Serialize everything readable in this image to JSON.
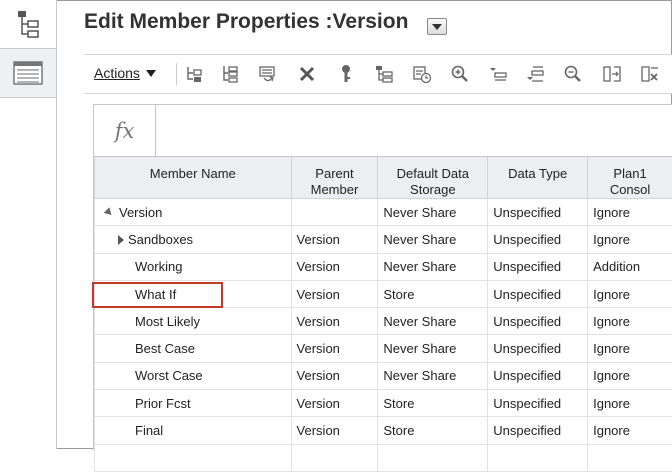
{
  "header": {
    "title": "Edit Member Properties :Version"
  },
  "toolbar": {
    "actions_label": "Actions",
    "icons": [
      "add-sibling-icon",
      "add-child-icon",
      "edit-member-icon",
      "delete-icon",
      "key-icon",
      "tree-view-icon",
      "history-icon",
      "zoom-in-icon",
      "move-up-icon",
      "move-down-icon",
      "zoom-out-icon",
      "expand-column-icon",
      "clear-filter-icon"
    ]
  },
  "formula_bar": {
    "label": "fx"
  },
  "grid": {
    "columns": [
      "Member Name",
      "Parent\nMember",
      "Default Data\nStorage",
      "Data Type",
      "Plan1\nConsol"
    ],
    "rows": [
      {
        "name": "Version",
        "parent": "",
        "storage": "Never Share",
        "type": "Unspecified",
        "consol": "Ignore",
        "level": 0,
        "toggle": "expanded"
      },
      {
        "name": "Sandboxes",
        "parent": "Version",
        "storage": "Never Share",
        "type": "Unspecified",
        "consol": "Ignore",
        "level": 1,
        "toggle": "collapsed"
      },
      {
        "name": "Working",
        "parent": "Version",
        "storage": "Never Share",
        "type": "Unspecified",
        "consol": "Addition",
        "level": 1,
        "toggle": ""
      },
      {
        "name": "What If",
        "parent": "Version",
        "storage": "Store",
        "type": "Unspecified",
        "consol": "Ignore",
        "level": 1,
        "toggle": ""
      },
      {
        "name": "Most Likely",
        "parent": "Version",
        "storage": "Never Share",
        "type": "Unspecified",
        "consol": "Ignore",
        "level": 1,
        "toggle": ""
      },
      {
        "name": "Best Case",
        "parent": "Version",
        "storage": "Never Share",
        "type": "Unspecified",
        "consol": "Ignore",
        "level": 1,
        "toggle": ""
      },
      {
        "name": "Worst Case",
        "parent": "Version",
        "storage": "Never Share",
        "type": "Unspecified",
        "consol": "Ignore",
        "level": 1,
        "toggle": ""
      },
      {
        "name": "Prior Fcst",
        "parent": "Version",
        "storage": "Store",
        "type": "Unspecified",
        "consol": "Ignore",
        "level": 1,
        "toggle": ""
      },
      {
        "name": "Final",
        "parent": "Version",
        "storage": "Store",
        "type": "Unspecified",
        "consol": "Ignore",
        "level": 1,
        "toggle": ""
      },
      {
        "name": "",
        "parent": "",
        "storage": "",
        "type": "",
        "consol": "",
        "level": 1,
        "toggle": ""
      }
    ]
  },
  "colors": {
    "highlight": "#c0392b",
    "header_bg": "#eceef1"
  }
}
